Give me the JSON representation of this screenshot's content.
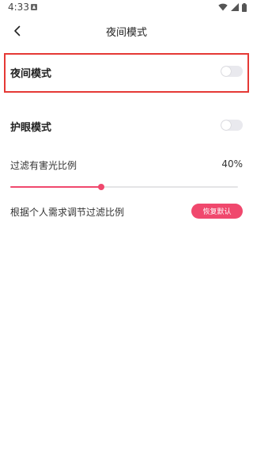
{
  "status_bar": {
    "time": "4:33"
  },
  "header": {
    "title": "夜间模式"
  },
  "night_mode": {
    "label": "夜间模式",
    "enabled": false
  },
  "eye_care": {
    "label": "护眼模式",
    "enabled": false
  },
  "filter": {
    "label": "过滤有害光比例",
    "value_text": "40%",
    "value": 0.4
  },
  "adjust": {
    "label": "根据个人需求调节过滤比例",
    "reset_label": "恢复默认"
  },
  "colors": {
    "accent": "#f0486d",
    "highlight_border": "#e53935"
  }
}
